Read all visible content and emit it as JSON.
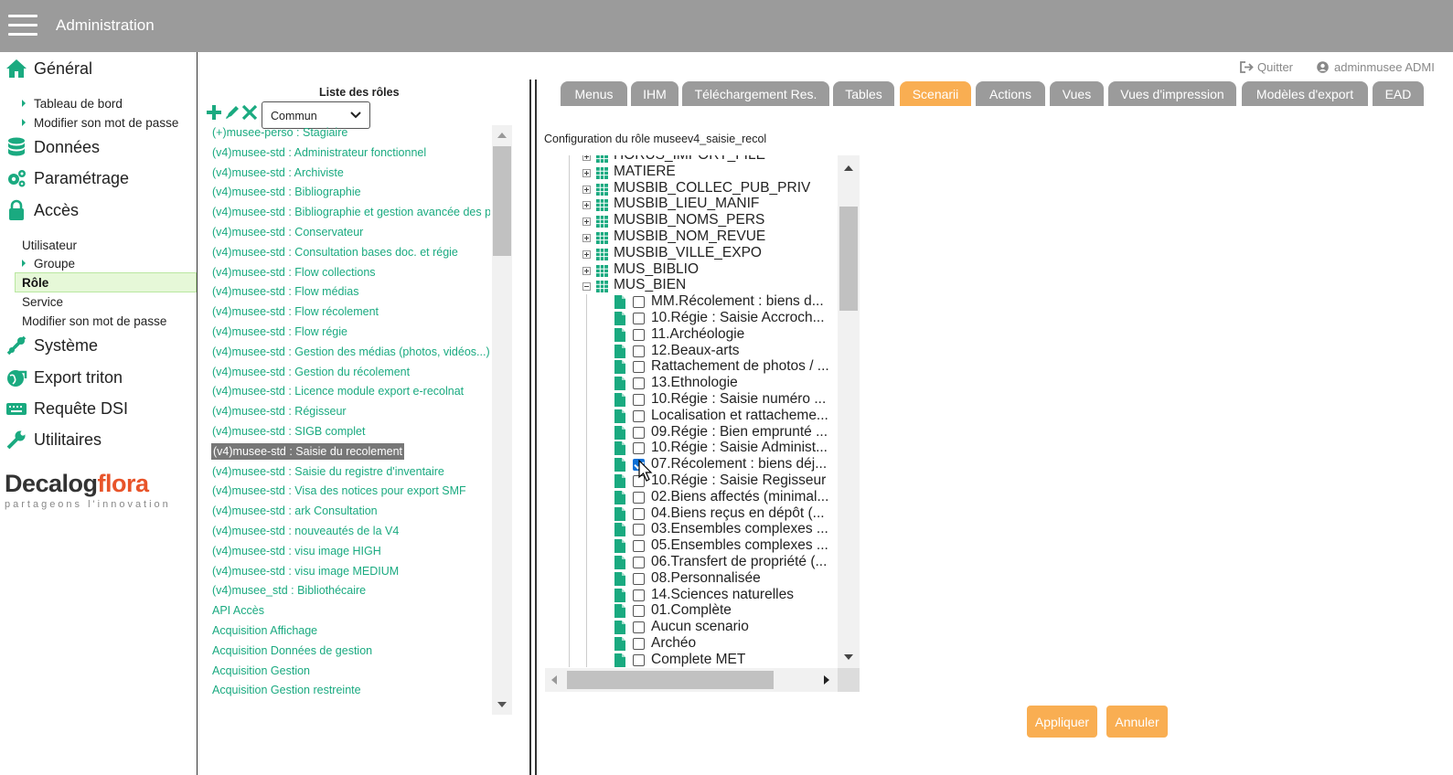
{
  "header": {
    "title": "Administration"
  },
  "sidebar": {
    "general": "Général",
    "general_items": [
      "Tableau de bord",
      "Modifier son mot de passe"
    ],
    "donnees": "Données",
    "parametrage": "Paramétrage",
    "acces": "Accès",
    "acces_items": [
      "Utilisateur",
      "Groupe",
      "Rôle",
      "Service",
      "Modifier son mot de passe"
    ],
    "systeme": "Système",
    "export_triton": "Export triton",
    "requete_dsi": "Requête DSI",
    "utilitaires": "Utilitaires",
    "logo": {
      "part1": "Decalog",
      "part2": "flora",
      "tagline": "partageons l'innovation"
    }
  },
  "roles": {
    "title": "Liste des rôles",
    "filter": {
      "selected": "Commun"
    },
    "items": [
      "(+)musee-perso : Stagiaire",
      "(v4)musee-std : Administrateur fonctionnel",
      "(v4)musee-std : Archiviste",
      "(v4)musee-std : Bibliographie",
      "(v4)musee-std : Bibliographie et gestion avancée des p",
      "(v4)musee-std : Conservateur",
      "(v4)musee-std : Consultation bases doc. et régie",
      "(v4)musee-std : Flow collections",
      "(v4)musee-std : Flow médias",
      "(v4)musee-std : Flow récolement",
      "(v4)musee-std : Flow régie",
      "(v4)musee-std : Gestion des médias (photos, vidéos...)",
      "(v4)musee-std : Gestion du récolement",
      "(v4)musee-std : Licence module export e-recolnat",
      "(v4)musee-std : Régisseur",
      "(v4)musee-std : SIGB complet",
      "(v4)musee-std : Saisie du recolement",
      "(v4)musee-std : Saisie du registre d'inventaire",
      "(v4)musee-std : Visa des notices pour export SMF",
      "(v4)musee-std : ark Consultation",
      "(v4)musee-std : nouveautés de la V4",
      "(v4)musee-std : visu image HIGH",
      "(v4)musee-std : visu image MEDIUM",
      "(v4)musee_std : Bibliothécaire",
      "API Accès",
      "Acquisition Affichage",
      "Acquisition Données de gestion",
      "Acquisition Gestion",
      "Acquisition Gestion restreinte"
    ],
    "selected_index": 16
  },
  "topright": {
    "quit": "Quitter",
    "user": "adminmusee ADMI"
  },
  "tabs": [
    "Menus",
    "IHM",
    "Téléchargement Res.",
    "Tables",
    "Scenarii",
    "Actions",
    "Vues",
    "Vues d'impression",
    "Modèles d'export",
    "EAD"
  ],
  "active_tab": "Scenarii",
  "config_label": "Configuration du rôle museev4_saisie_recol",
  "tree": {
    "tables": [
      "HORUS_IMPORT_FILE",
      "MATIERE",
      "MUSBIB_COLLEC_PUB_PRIV",
      "MUSBIB_LIEU_MANIF",
      "MUSBIB_NOMS_PERS",
      "MUSBIB_NOM_REVUE",
      "MUSBIB_VILLE_EXPO",
      "MUS_BIBLIO",
      "MUS_BIEN"
    ],
    "scenarios": [
      {
        "label": "MM.Récolement : biens d...",
        "checked": false
      },
      {
        "label": "10.Régie : Saisie Accroch...",
        "checked": false
      },
      {
        "label": "11.Archéologie",
        "checked": false
      },
      {
        "label": "12.Beaux-arts",
        "checked": false
      },
      {
        "label": "Rattachement de photos / ...",
        "checked": false
      },
      {
        "label": "13.Ethnologie",
        "checked": false
      },
      {
        "label": "10.Régie : Saisie numéro ...",
        "checked": false
      },
      {
        "label": "Localisation et rattacheme...",
        "checked": false
      },
      {
        "label": "09.Régie : Bien emprunté ...",
        "checked": false
      },
      {
        "label": "10.Régie : Saisie Administ...",
        "checked": false
      },
      {
        "label": "07.Récolement : biens déj...",
        "checked": true
      },
      {
        "label": "10.Régie : Saisie Regisseur",
        "checked": false
      },
      {
        "label": "02.Biens affectés (minimal...",
        "checked": false
      },
      {
        "label": "04.Biens reçus en dépôt (...",
        "checked": false
      },
      {
        "label": "03.Ensembles complexes ...",
        "checked": false
      },
      {
        "label": "05.Ensembles complexes ...",
        "checked": false
      },
      {
        "label": "06.Transfert de propriété (...",
        "checked": false
      },
      {
        "label": "08.Personnalisée",
        "checked": false
      },
      {
        "label": "14.Sciences naturelles",
        "checked": false
      },
      {
        "label": "01.Complète",
        "checked": false
      },
      {
        "label": "Aucun scenario",
        "checked": false
      },
      {
        "label": "Archéo",
        "checked": false
      },
      {
        "label": "Complete MET",
        "checked": false
      }
    ]
  },
  "buttons": {
    "apply": "Appliquer",
    "cancel": "Annuler"
  },
  "colors": {
    "topbar": "#9b9b9b",
    "accent_green": "#1aaa80",
    "tab_active": "#f9ae52",
    "tab": "#9b9b9b"
  }
}
